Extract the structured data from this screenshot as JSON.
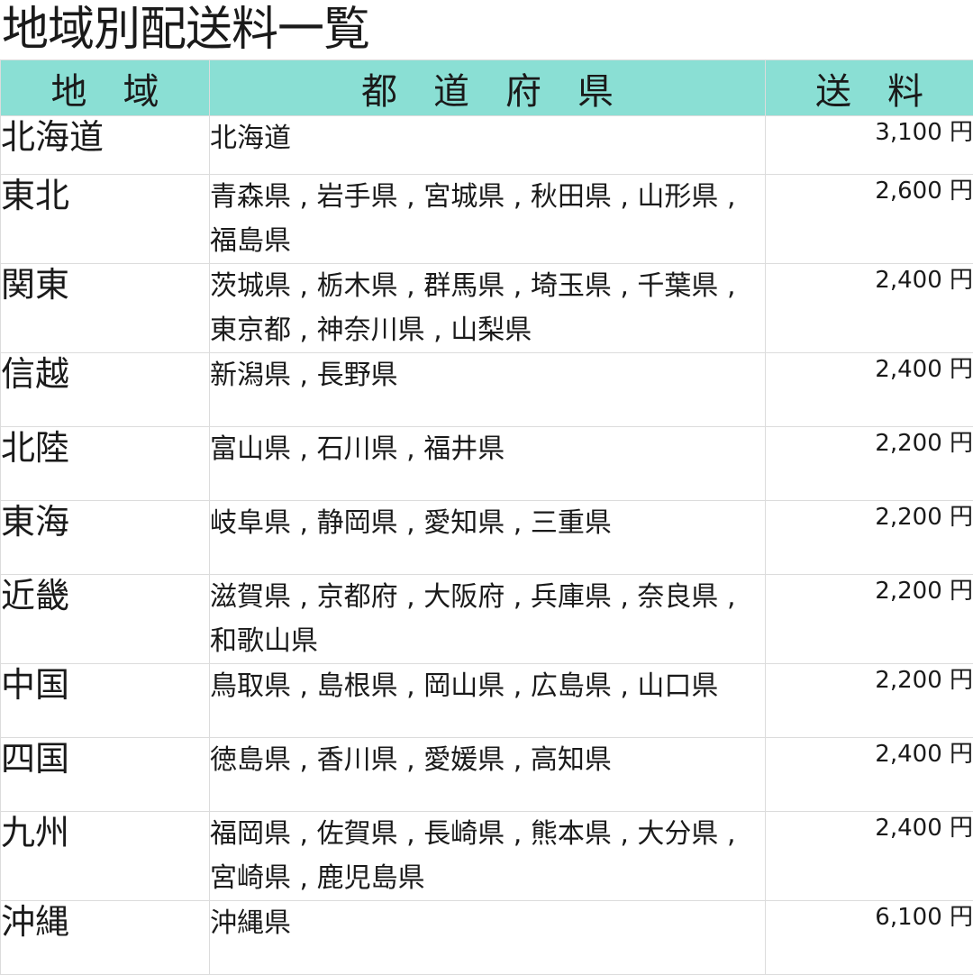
{
  "title": "地域別配送料一覧",
  "table": {
    "headers": {
      "region": "地　域",
      "prefectures": "都　道　府　県",
      "fee": "送　料"
    },
    "rows": [
      {
        "region": "北海道",
        "prefectures": "北海道",
        "fee": "3,100 円"
      },
      {
        "region": "東北",
        "prefectures": "青森県 , 岩手県 , 宮城県 , 秋田県 , 山形県 , 福島県",
        "fee": "2,600 円"
      },
      {
        "region": "関東",
        "prefectures": "茨城県 , 栃木県 , 群馬県 , 埼玉県 , 千葉県 , 東京都 , 神奈川県 , 山梨県",
        "fee": "2,400 円"
      },
      {
        "region": "信越",
        "prefectures": "新潟県 , 長野県",
        "fee": "2,400 円"
      },
      {
        "region": "北陸",
        "prefectures": "富山県 , 石川県 , 福井県",
        "fee": "2,200 円"
      },
      {
        "region": "東海",
        "prefectures": "岐阜県 , 静岡県 , 愛知県 , 三重県",
        "fee": "2,200 円"
      },
      {
        "region": "近畿",
        "prefectures": "滋賀県 , 京都府 , 大阪府 , 兵庫県 , 奈良県 , 和歌山県",
        "fee": "2,200 円"
      },
      {
        "region": "中国",
        "prefectures": "鳥取県 , 島根県 , 岡山県 , 広島県 , 山口県",
        "fee": "2,200 円"
      },
      {
        "region": "四国",
        "prefectures": "徳島県 , 香川県 , 愛媛県 , 高知県",
        "fee": "2,400 円"
      },
      {
        "region": "九州",
        "prefectures": "福岡県 , 佐賀県 , 長崎県 , 熊本県 , 大分県 , 宮崎県 , 鹿児島県",
        "fee": "2,400 円"
      },
      {
        "region": "沖縄",
        "prefectures": "沖縄県",
        "fee": "6,100 円"
      }
    ]
  },
  "colors": {
    "header_background": "#8adfd4",
    "grid_line": "#dcdcdc"
  }
}
